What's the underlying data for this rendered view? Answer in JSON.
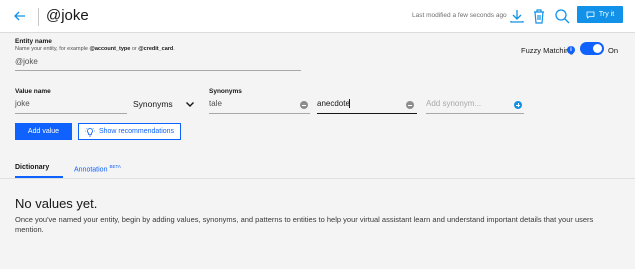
{
  "header": {
    "entity_title": "@joke",
    "last_modified": "Last modified a few seconds ago",
    "try_it_label": "Try it"
  },
  "entity": {
    "label": "Entity name",
    "helper_prefix": "Name your entity, for example ",
    "helper_example1": "@account_type",
    "helper_or": " or ",
    "helper_example2": "@credit_card",
    "helper_suffix": ".",
    "value": "@joke"
  },
  "fuzzy": {
    "label": "Fuzzy Matching",
    "info": "i",
    "state_label": "On",
    "enabled": true
  },
  "value_form": {
    "value_label": "Value name",
    "value": "joke",
    "type_select": "Synonyms",
    "synonyms_label": "Synonyms",
    "synonym1": "tale",
    "synonym2": "anecdote",
    "add_placeholder": "Add synonym..."
  },
  "buttons": {
    "add_value": "Add value",
    "show_recommendations": "Show recommendations"
  },
  "tabs": {
    "dictionary": "Dictionary",
    "annotation": "Annotation",
    "annotation_badge": "BETA"
  },
  "empty_state": {
    "title": "No values yet.",
    "description": "Once you've named your entity, begin by adding values, synonyms, and patterns to entities to help your virtual assistant learn and understand important details that your users mention."
  },
  "colors": {
    "primary": "#0f62fe",
    "try_it": "#1192e8"
  }
}
